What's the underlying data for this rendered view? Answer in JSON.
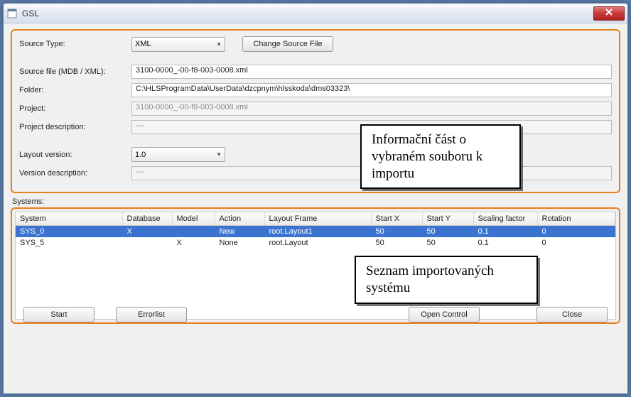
{
  "window": {
    "title": "GSL"
  },
  "topbox": {
    "source_type_label": "Source Type:",
    "source_type_value": "XML",
    "change_button": "Change Source File",
    "source_file_label": "Source file (MDB / XML):",
    "source_file_value": "3100-0000_-00-f8-003-0008.xml",
    "folder_label": "Folder:",
    "folder_value": "C:\\HLSProgramData\\UserData\\dzcpnym\\hlsskoda\\dms03323\\",
    "project_label": "Project:",
    "project_value": "3100-0000_-00-f8-003-0008.xml",
    "project_desc_label": "Project description:",
    "project_desc_value": "---",
    "layout_ver_label": "Layout version:",
    "layout_ver_value": "1.0",
    "version_desc_label": "Version description:",
    "version_desc_value": "---"
  },
  "callout1": "Informační část o vybraném souboru k importu",
  "systems_label": "Systems:",
  "table": {
    "headers": [
      "System",
      "Database",
      "Model",
      "Action",
      "Layout Frame",
      "Start X",
      "Start Y",
      "Scaling factor",
      "Rotation"
    ],
    "rows": [
      {
        "selected": true,
        "cells": [
          "SYS_0",
          "X",
          "",
          "New",
          "root.Layout1",
          "50",
          "50",
          "0.1",
          "0"
        ]
      },
      {
        "selected": false,
        "cells": [
          "SYS_5",
          "",
          "X",
          "None",
          "root.Layout",
          "50",
          "50",
          "0.1",
          "0"
        ]
      }
    ]
  },
  "callout2": "Seznam importovaných systému",
  "footer": {
    "start": "Start",
    "errorlist": "Errorlist",
    "open_control": "Open Control",
    "close": "Close"
  }
}
